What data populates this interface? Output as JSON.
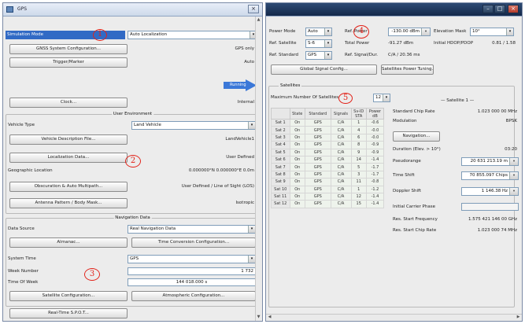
{
  "left": {
    "title": "GPS",
    "sim_mode_label": "Simulation Mode",
    "sim_mode_value": "Auto Localization",
    "gnss_btn": "GNSS System Configuration...",
    "gnss_value": "GPS only",
    "trigger_btn": "Trigger/Marker",
    "trigger_value": "Auto",
    "running_label": "Running",
    "clock_btn": "Clock...",
    "clock_value": "Internal",
    "user_env": {
      "title": "User Environment",
      "vehicle_label": "Vehicle Type",
      "vehicle_value": "Land Vehicle",
      "vehicle_desc_btn": "Vehicle Description File...",
      "vehicle_desc_value": "LandVehicle1",
      "loc_btn": "Localization Data...",
      "loc_value": "User Defined",
      "geo_label": "Geographic Location",
      "geo_value": "0.000000°N 0.000000°E 0.0m",
      "obs_btn": "Obscuration & Auto Multipath...",
      "obs_value": "User Defined / Line of Sight (LOS)",
      "antenna_btn": "Antenna Pattern / Body Mask...",
      "antenna_value": "Isotropic"
    },
    "nav_data": {
      "title": "Navigation Data",
      "source_label": "Data Source",
      "source_value": "Real Navigation Data",
      "almanac_btn": "Almanac...",
      "time_conv_btn": "Time Conversion Configuration...",
      "sys_time_label": "System Time",
      "sys_time_value": "GPS",
      "week_label": "Week Number",
      "week_value": "1 732",
      "tow_label": "Time Of Week",
      "tow_value": "144 018.000 s",
      "sat_cfg_btn": "Satellite Configuration...",
      "atmo_btn": "Atmospheric Configuration...",
      "realtime_btn": "Real-Time S.P.O.T..."
    }
  },
  "right": {
    "power_mode_label": "Power Mode",
    "power_mode_value": "Auto",
    "ref_power_label": "Ref. Power",
    "ref_power_value": "-130.00 dBm",
    "elev_mask_label": "Elevation Mask",
    "elev_mask_value": "10°",
    "ref_sat_label": "Ref. Satellite",
    "ref_sat_value": "S-6",
    "total_power_label": "Total Power",
    "total_power_value": "-91.27 dBm",
    "initial_hdop_label": "Initial HDOP/PDOP",
    "initial_hdop_value": "0.81 / 1.58",
    "ref_standard_label": "Ref. Standard",
    "ref_standard_value": "GPS",
    "ref_signal_label": "Ref. Signal/Dur.",
    "ref_signal_value": "C/A / 20.36 ms",
    "global_btn": "Global Signal Config...",
    "sat_power_btn": "Satellites Power Tuning...",
    "satellites_group": "Satellites",
    "max_sats_label": "Maximum Number Of Satellites",
    "max_sats_value": "12",
    "table_headers": [
      "",
      "State",
      "Standard",
      "Signals",
      "Sv-ID\nSTA",
      "Power\ndB"
    ],
    "table_rows": [
      [
        "Sat 1",
        "On",
        "GPS",
        "C/A",
        "1",
        "-0.6"
      ],
      [
        "Sat 2",
        "On",
        "GPS",
        "C/A",
        "4",
        "-0.0"
      ],
      [
        "Sat 3",
        "On",
        "GPS",
        "C/A",
        "6",
        "-0.0"
      ],
      [
        "Sat 4",
        "On",
        "GPS",
        "C/A",
        "8",
        "-0.9"
      ],
      [
        "Sat 5",
        "On",
        "GPS",
        "C/A",
        "9",
        "-0.9"
      ],
      [
        "Sat 6",
        "On",
        "GPS",
        "C/A",
        "14",
        "-1.4"
      ],
      [
        "Sat 7",
        "On",
        "GPS",
        "C/A",
        "5",
        "-1.7"
      ],
      [
        "Sat 8",
        "On",
        "GPS",
        "C/A",
        "3",
        "-1.7"
      ],
      [
        "Sat 9",
        "On",
        "GPS",
        "C/A",
        "11",
        "-0.8"
      ],
      [
        "Sat 10",
        "On",
        "GPS",
        "C/A",
        "1",
        "-1.2"
      ],
      [
        "Sat 11",
        "On",
        "GPS",
        "C/A",
        "12",
        "-1.4"
      ],
      [
        "Sat 12",
        "On",
        "GPS",
        "C/A",
        "15",
        "-1.4"
      ]
    ],
    "detail_title": "Satellite 1",
    "std_chip_label": "Standard Chip Rate",
    "std_chip_value": "1.023 000 00 MHz",
    "modulation_label": "Modulation",
    "modulation_value": "BPSK",
    "navigation_btn": "Navigation...",
    "duration_label": "Duration (Elev. > 10°)",
    "duration_value": "03:20",
    "pseudorange_label": "Pseudorange",
    "pseudorange_value": "20 631 213.19 m",
    "time_shift_label": "Time Shift",
    "time_shift_value": "70 855.097 Chips",
    "doppler_label": "Doppler Shift",
    "doppler_value": "1 146.38 Hz",
    "carrier_phase_label": "Initial Carrier Phase",
    "carrier_phase_value": "0.00",
    "res_freq_label": "Res. Start Frequency",
    "res_freq_value": "1.575 421 146 00 GHz",
    "res_chip_label": "Res. Start Chip Rate",
    "res_chip_value": "1.023 000 74 MHz"
  },
  "annotations": [
    "1",
    "2",
    "3",
    "4",
    "5"
  ]
}
